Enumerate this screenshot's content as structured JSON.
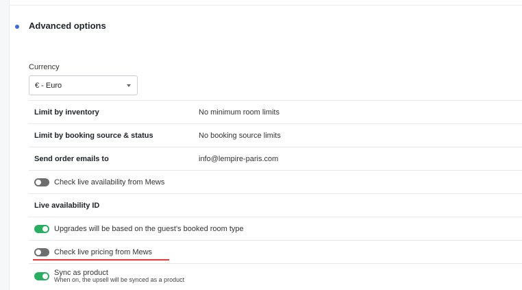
{
  "section": {
    "title": "Advanced options",
    "accent_color": "#3d6bd9"
  },
  "currency": {
    "label": "Currency",
    "selected": "€ - Euro"
  },
  "rows": {
    "inventory": {
      "label": "Limit by inventory",
      "value": "No minimum room limits"
    },
    "booking_source": {
      "label": "Limit by booking source & status",
      "value": "No booking source limits"
    },
    "order_emails": {
      "label": "Send order emails to",
      "value": "info@lempire-paris.com"
    },
    "live_availability": {
      "label": "Check live availability from Mews",
      "state": "off"
    },
    "live_availability_id": {
      "label": "Live availability ID"
    },
    "upgrades": {
      "label": "Upgrades will be based on the guest's booked room type",
      "state": "on"
    },
    "live_pricing": {
      "label": "Check live pricing from Mews",
      "state": "off"
    },
    "sync_product": {
      "label": "Sync as product",
      "description": "When on, the upsell will be synced as a product",
      "state": "on"
    }
  },
  "colors": {
    "toggle_on": "#27ae60",
    "toggle_off": "#6e6e6e",
    "highlight": "#e53935"
  }
}
